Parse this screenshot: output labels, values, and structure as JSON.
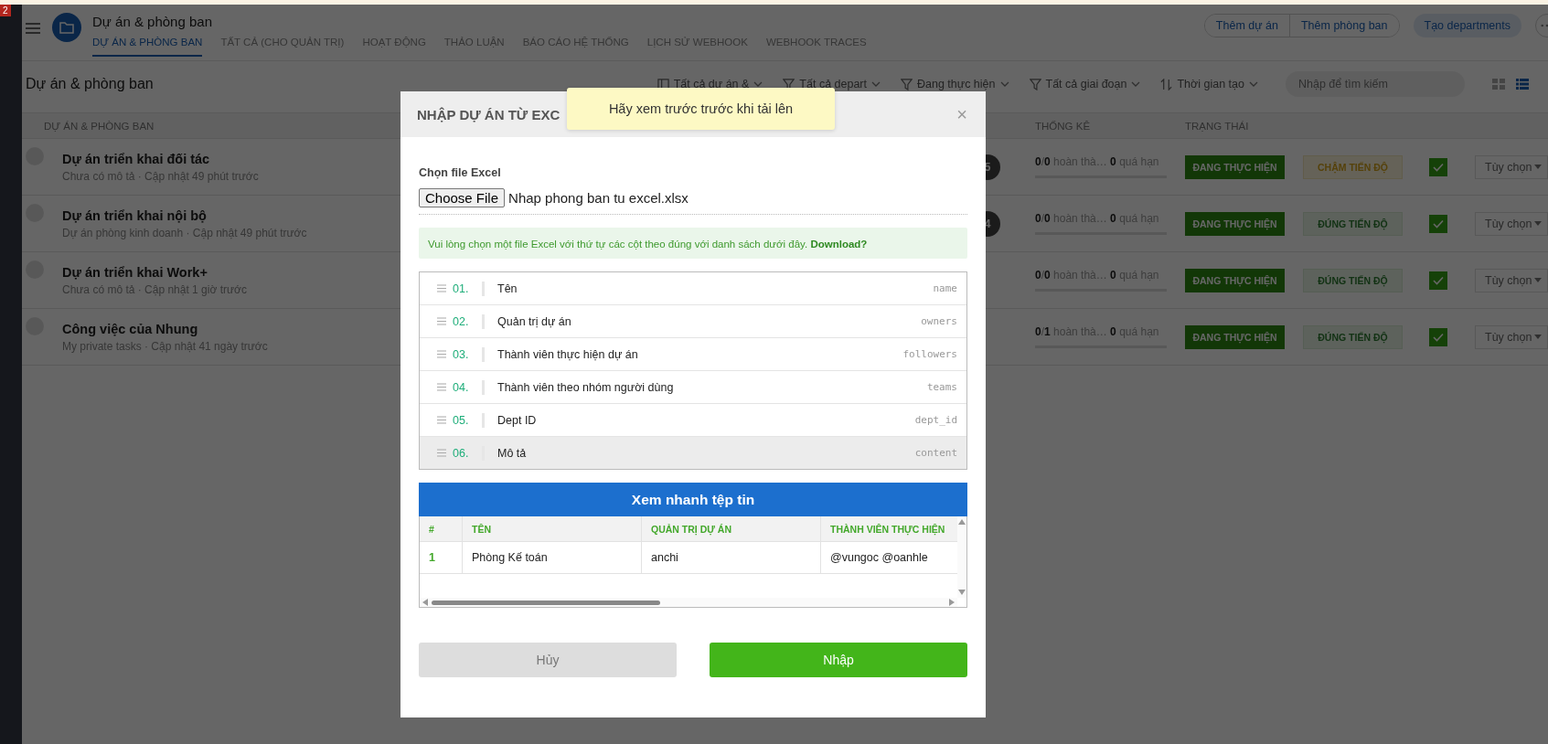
{
  "app_header": {
    "notification_count": "2",
    "title": "Dự án & phòng ban",
    "tabs": [
      {
        "label": "DỰ ÁN & PHÒNG BAN",
        "selected": true
      },
      {
        "label": "TẤT CẢ (CHO QUẢN TRỊ)",
        "selected": false
      },
      {
        "label": "HOẠT ĐỘNG",
        "selected": false
      },
      {
        "label": "THẢO LUẬN",
        "selected": false
      },
      {
        "label": "BÁO CÁO HỆ THỐNG",
        "selected": false
      },
      {
        "label": "LỊCH SỬ WEBHOOK",
        "selected": false
      },
      {
        "label": "WEBHOOK TRACES",
        "selected": false
      }
    ],
    "actions": [
      "Thêm dự án",
      "Thêm phòng ban"
    ],
    "primary_action": "Tạo departments"
  },
  "toolbar": {
    "title": "Dự án & phòng ban",
    "filters": [
      {
        "kind": "scope",
        "label": "Tất cả dự án &"
      },
      {
        "kind": "filter",
        "label": "Tất cả depart"
      },
      {
        "kind": "filter",
        "label": "Đang thực hiện"
      },
      {
        "kind": "filter",
        "label": "Tất cả giai đoạn"
      },
      {
        "kind": "sort",
        "label": "Thời gian tạo"
      }
    ],
    "search": {
      "placeholder": "Nhập để tìm kiếm"
    },
    "views": [
      {
        "kind": "grid",
        "selected": false
      },
      {
        "kind": "list",
        "selected": true
      }
    ]
  },
  "table": {
    "columns": [
      "DỰ ÁN & PHÒNG BAN",
      "THỐNG KÊ",
      "TRẠNG THÁI"
    ],
    "rows": [
      {
        "name": "Dự án triển khai đối tác",
        "subtitle": "Chưa có mô tả · Cập nhật 49 phút trước",
        "badge": "5",
        "stats": "**0**/**0** hoàn thà… **0** quá hạn",
        "status": "ĐANG THỰC HIỆN",
        "progress": {
          "kind": "late",
          "label": "CHẬM TIẾN ĐỘ"
        },
        "checked": true,
        "options": "Tùy chọn"
      },
      {
        "name": "Dự án triển khai nội bộ",
        "subtitle": "Dự án phòng kinh doanh · Cập nhật 49 phút trước",
        "badge": "4",
        "stats": "**0**/**0** hoàn thà… **0** quá hạn",
        "status": "ĐANG THỰC HIỆN",
        "progress": {
          "kind": "on_time",
          "label": "ĐÚNG TIẾN ĐỘ"
        },
        "checked": true,
        "options": "Tùy chọn"
      },
      {
        "name": "Dự án triển khai Work+",
        "subtitle": "Chưa có mô tả · Cập nhật 1 giờ trước",
        "stats": "**0**/**0** hoàn thà… **0** quá hạn",
        "status": "ĐANG THỰC HIỆN",
        "progress": {
          "kind": "on_time",
          "label": "ĐÚNG TIẾN ĐỘ"
        },
        "checked": true,
        "options": "Tùy chọn"
      },
      {
        "name": "Công việc của Nhung",
        "subtitle": "My private tasks · Cập nhật 41 ngày trước",
        "stats": "**0**/**1** hoàn thà… **0** quá hạn",
        "status": "ĐANG THỰC HIỆN",
        "progress": {
          "kind": "on_time",
          "label": "ĐÚNG TIẾN ĐỘ"
        },
        "checked": true,
        "options": "Tùy chọn"
      }
    ]
  },
  "modal": {
    "title": "NHẬP DỰ ÁN TỪ EXC",
    "close": "×",
    "toast": "Hãy xem trước trước khi tải lên",
    "file_label": "Chọn file Excel",
    "file_button": "Choose File",
    "file_name": "Nhap phong ban tu excel.xlsx",
    "info": "Vui lòng chọn một file Excel với thứ tự các cột theo đúng với danh sách dưới đây.",
    "info_link": "Download?",
    "columns": [
      {
        "number": "01.",
        "label": "Tên",
        "key": "name",
        "hovered": false
      },
      {
        "number": "02.",
        "label": "Quản trị dự án",
        "key": "owners",
        "hovered": false
      },
      {
        "number": "03.",
        "label": "Thành viên thực hiện dự án",
        "key": "followers",
        "hovered": false
      },
      {
        "number": "04.",
        "label": "Thành viên theo nhóm người dùng",
        "key": "teams",
        "hovered": false
      },
      {
        "number": "05.",
        "label": "Dept ID",
        "key": "dept_id",
        "hovered": false
      },
      {
        "number": "06.",
        "label": "Mô tả",
        "key": "content",
        "hovered": true
      }
    ],
    "preview": {
      "title": "Xem nhanh tệp tin",
      "columns": [
        "#",
        "TÊN",
        "QUẢN TRỊ DỰ ÁN",
        "THÀNH VIÊN THỰC HIỆN"
      ],
      "rows": [
        [
          "1",
          "Phòng Kế toán",
          "anchi",
          "@vungoc @oanhle"
        ]
      ]
    },
    "buttons": [
      {
        "kind": "cancel",
        "label": "Hủy"
      },
      {
        "kind": "primary",
        "label": "Nhập"
      }
    ]
  }
}
